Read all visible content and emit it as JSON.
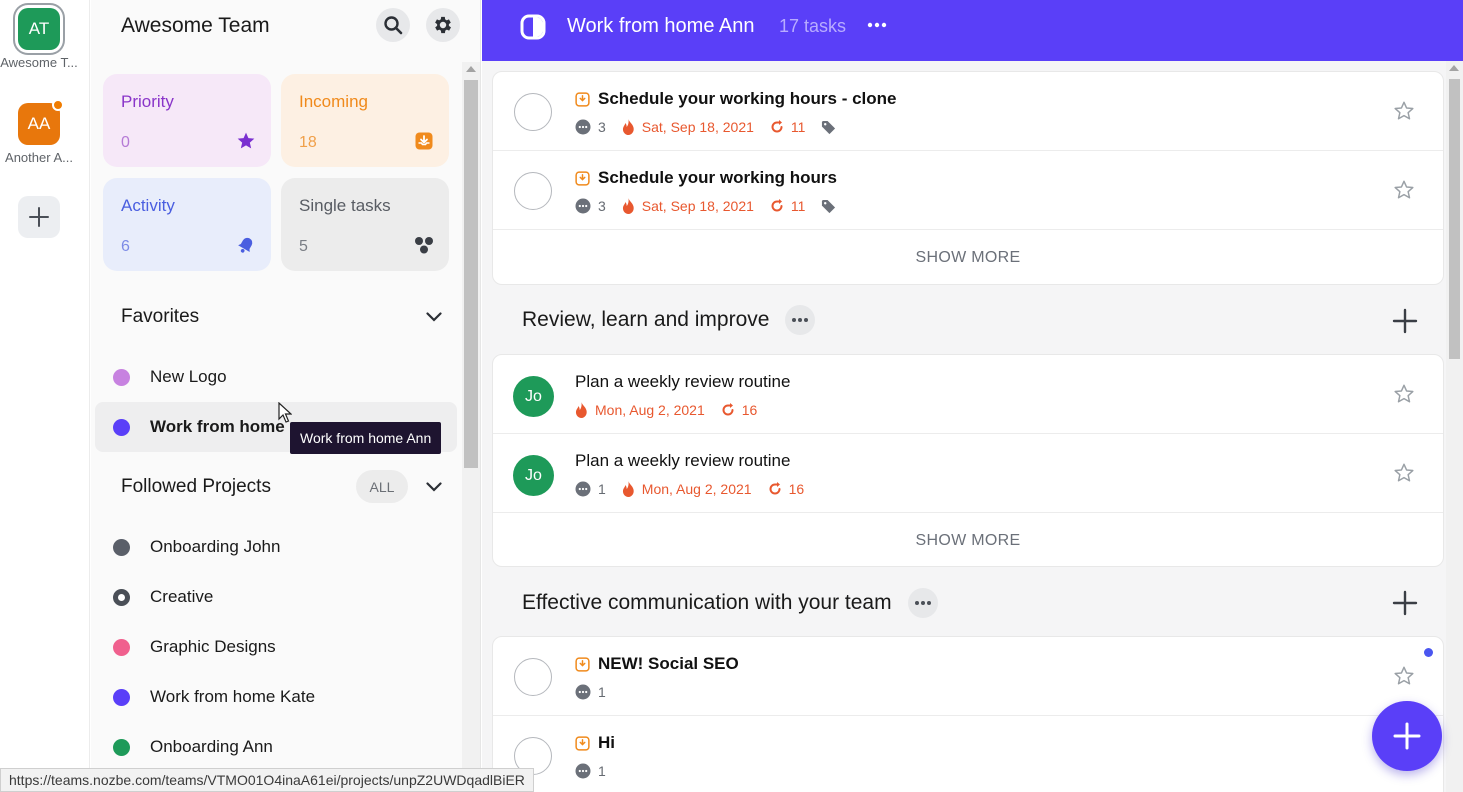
{
  "workspaces": [
    {
      "initials": "AT",
      "label": "Awesome T...",
      "color": "#1e9a59",
      "active": true
    },
    {
      "initials": "AA",
      "label": "Another A...",
      "color": "#e8770c",
      "notification": true
    }
  ],
  "sidebar": {
    "team_name": "Awesome Team",
    "icons": {
      "search": "search-icon",
      "settings": "gear-icon"
    },
    "cards": [
      {
        "label": "Priority",
        "count": "0",
        "icon": "star-icon",
        "bg": "#f6e8f8",
        "color": "#8a35c9"
      },
      {
        "label": "Incoming",
        "count": "18",
        "icon": "inbox-icon",
        "bg": "#fdf0e3",
        "color": "#f08a1c"
      },
      {
        "label": "Activity",
        "count": "6",
        "icon": "bell-icon",
        "bg": "#e8edfb",
        "color": "#4a5ee0"
      },
      {
        "label": "Single tasks",
        "count": "5",
        "icon": "dots-cluster-icon",
        "bg": "#ececec",
        "color": "#585c63"
      }
    ],
    "favorites": {
      "title": "Favorites",
      "items": [
        {
          "label": "New Logo",
          "color": "#c782e0"
        },
        {
          "label": "Work from home Ann",
          "color": "#5a3ff8",
          "selected": true
        }
      ]
    },
    "followed": {
      "title": "Followed Projects",
      "filter": "ALL",
      "items": [
        {
          "label": "Onboarding John",
          "color": "#5a5f69"
        },
        {
          "label": "Creative",
          "color": "#4a4f57",
          "ring": true
        },
        {
          "label": "Graphic Designs",
          "color": "#f0608e"
        },
        {
          "label": "Work from home Kate",
          "color": "#5a3ff8"
        },
        {
          "label": "Onboarding Ann",
          "color": "#1e9a59"
        }
      ]
    },
    "tooltip": "Work from home Ann",
    "selected_truncated": "Work from home "
  },
  "header": {
    "title": "Work from home Ann",
    "task_count": "17 tasks",
    "more": "•••"
  },
  "groups": [
    {
      "title": "",
      "tasks": [
        {
          "title": "Schedule your working hours - clone",
          "bold": true,
          "incoming": true,
          "comments": "3",
          "date": "Sat, Sep 18, 2021",
          "repeat": "11",
          "tag": true
        },
        {
          "title": "Schedule your working hours",
          "bold": true,
          "incoming": true,
          "comments": "3",
          "date": "Sat, Sep 18, 2021",
          "repeat": "11",
          "tag": true
        }
      ],
      "show_more": "SHOW MORE"
    },
    {
      "title": "Review, learn and improve",
      "tasks": [
        {
          "title": "Plan a weekly review routine",
          "assignee": "Jo",
          "date": "Mon, Aug 2, 2021",
          "repeat": "16"
        },
        {
          "title": "Plan a weekly review routine",
          "assignee": "Jo",
          "comments": "1",
          "date": "Mon, Aug 2, 2021",
          "repeat": "16"
        }
      ],
      "show_more": "SHOW MORE"
    },
    {
      "title": "Effective communication with your team",
      "tasks": [
        {
          "title": "NEW! Social SEO",
          "bold": true,
          "incoming": true,
          "comments": "1",
          "unread": true
        },
        {
          "title": "Hi",
          "bold": true,
          "incoming": true,
          "comments": "1"
        }
      ]
    }
  ],
  "status_url": "https://teams.nozbe.com/teams/VTMO01O4inaA61ei/projects/unpZ2UWDqadlBiER"
}
